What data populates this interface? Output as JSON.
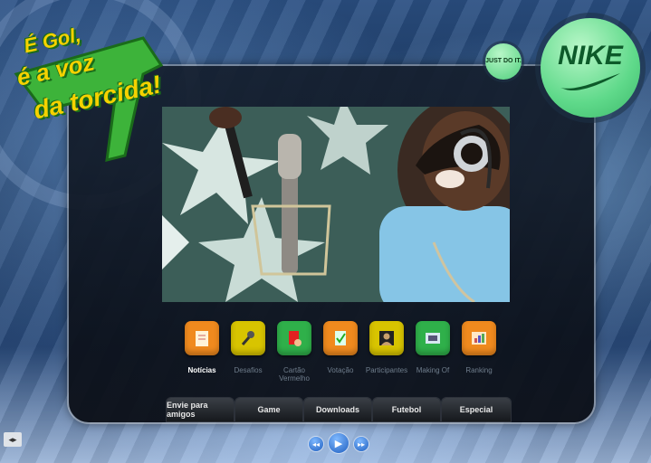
{
  "logo": {
    "line1": "É Gol,",
    "line2": "é a voz",
    "line3": "da torcida!"
  },
  "brand": {
    "nike": "NIKE",
    "slogan": "JUST DO IT."
  },
  "menu": [
    {
      "label": "Notícias",
      "icon": "notepad-icon",
      "color": "#f08a1e",
      "active": true
    },
    {
      "label": "Desafios",
      "icon": "microphone-icon",
      "color": "#d8c400",
      "active": false
    },
    {
      "label": "Cartão Vermelho",
      "icon": "red-card-icon",
      "color": "#2fb04a",
      "active": false
    },
    {
      "label": "Votação",
      "icon": "vote-icon",
      "color": "#f08a1e",
      "active": false
    },
    {
      "label": "Participantes",
      "icon": "person-icon",
      "color": "#d8c400",
      "active": false
    },
    {
      "label": "Making Of",
      "icon": "film-icon",
      "color": "#2fb04a",
      "active": false
    },
    {
      "label": "Ranking",
      "icon": "chart-icon",
      "color": "#f08a1e",
      "active": false
    }
  ],
  "tabs": [
    "Envie para amigos",
    "Game",
    "Downloads",
    "Futebol",
    "Especial"
  ],
  "controls": {
    "prev": "rewind-icon",
    "play": "play-icon",
    "next": "forward-icon"
  },
  "scroll": "◂▸"
}
